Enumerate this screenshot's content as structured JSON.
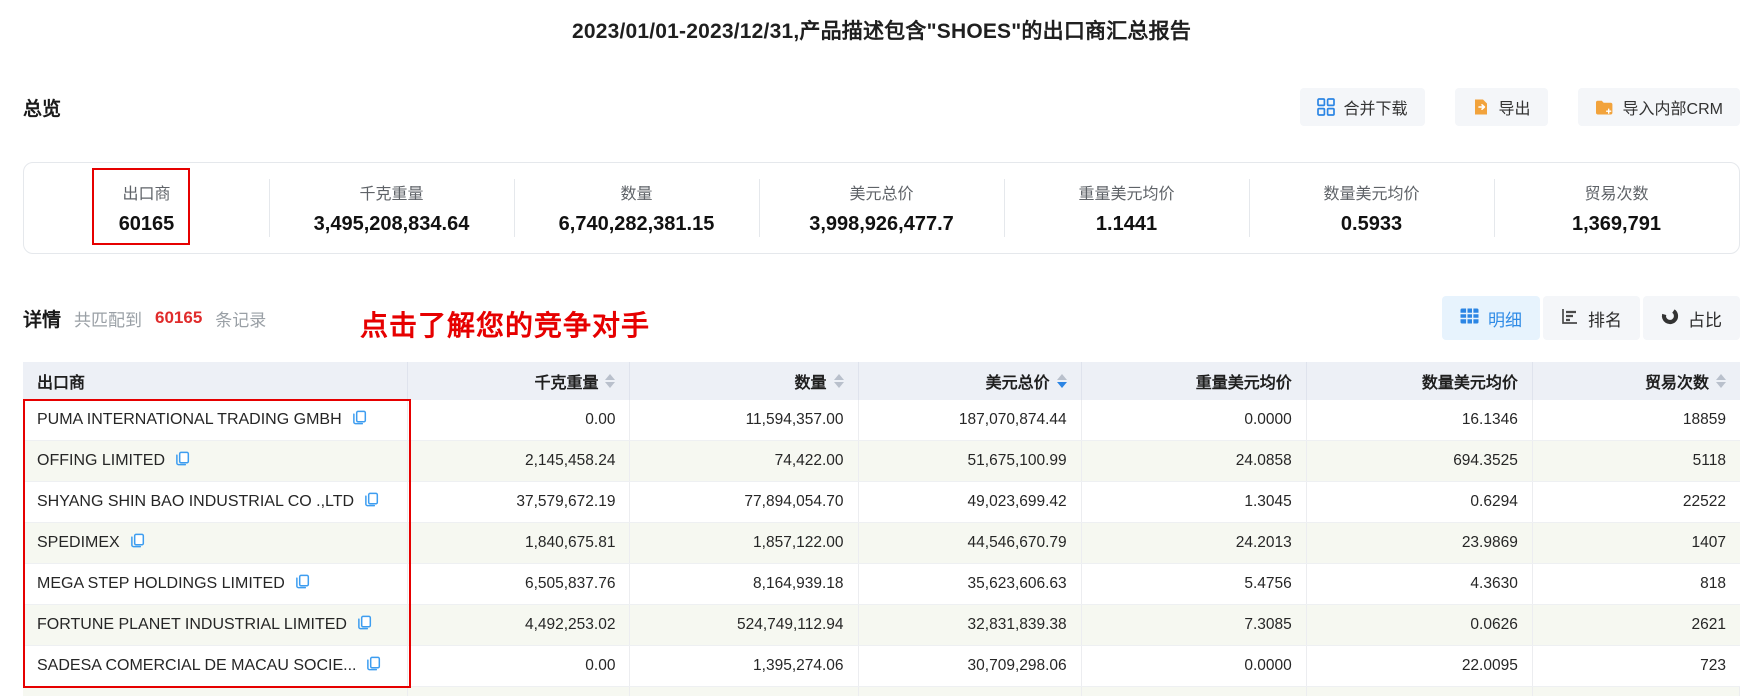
{
  "title": "2023/01/01-2023/12/31,产品描述包含\"SHOES\"的出口商汇总报告",
  "toolbar": {
    "section_title": "总览",
    "buttons": [
      {
        "label": "合并下载",
        "icon": "merge-download-icon"
      },
      {
        "label": "导出",
        "icon": "export-icon"
      },
      {
        "label": "导入内部CRM",
        "icon": "import-crm-icon"
      }
    ]
  },
  "stats": {
    "items": [
      {
        "label": "出口商",
        "value": "60165"
      },
      {
        "label": "千克重量",
        "value": "3,495,208,834.64"
      },
      {
        "label": "数量",
        "value": "6,740,282,381.15"
      },
      {
        "label": "美元总价",
        "value": "3,998,926,477.7"
      },
      {
        "label": "重量美元均价",
        "value": "1.1441"
      },
      {
        "label": "数量美元均价",
        "value": "0.5933"
      },
      {
        "label": "贸易次数",
        "value": "1,369,791"
      }
    ]
  },
  "details": {
    "section_title": "详情",
    "match_prefix": "共匹配到",
    "match_count": "60165",
    "match_suffix": "条记录",
    "annotation": "点击了解您的竞争对手",
    "view_buttons": [
      {
        "label": "明细",
        "icon": "table-grid-icon",
        "active": true
      },
      {
        "label": "排名",
        "icon": "ranking-bars-icon",
        "active": false
      },
      {
        "label": "占比",
        "icon": "donut-chart-icon",
        "active": false
      }
    ]
  },
  "table": {
    "columns": [
      {
        "label": "出口商",
        "sortable": false
      },
      {
        "label": "千克重量",
        "sortable": true
      },
      {
        "label": "数量",
        "sortable": true
      },
      {
        "label": "美元总价",
        "sortable": true,
        "sort": "desc"
      },
      {
        "label": "重量美元均价",
        "sortable": false
      },
      {
        "label": "数量美元均价",
        "sortable": false
      },
      {
        "label": "贸易次数",
        "sortable": true
      }
    ],
    "rows": [
      {
        "exporter": "PUMA INTERNATIONAL TRADING GMBH",
        "kg": "0.00",
        "qty": "11,594,357.00",
        "usd": "187,070,874.44",
        "usd_per_kg": "0.0000",
        "usd_per_qty": "16.1346",
        "trades": "18859"
      },
      {
        "exporter": "OFFING LIMITED",
        "kg": "2,145,458.24",
        "qty": "74,422.00",
        "usd": "51,675,100.99",
        "usd_per_kg": "24.0858",
        "usd_per_qty": "694.3525",
        "trades": "5118"
      },
      {
        "exporter": "SHYANG SHIN BAO INDUSTRIAL CO .,LTD",
        "kg": "37,579,672.19",
        "qty": "77,894,054.70",
        "usd": "49,023,699.42",
        "usd_per_kg": "1.3045",
        "usd_per_qty": "0.6294",
        "trades": "22522"
      },
      {
        "exporter": "SPEDIMEX",
        "kg": "1,840,675.81",
        "qty": "1,857,122.00",
        "usd": "44,546,670.79",
        "usd_per_kg": "24.2013",
        "usd_per_qty": "23.9869",
        "trades": "1407"
      },
      {
        "exporter": "MEGA STEP HOLDINGS LIMITED",
        "kg": "6,505,837.76",
        "qty": "8,164,939.18",
        "usd": "35,623,606.63",
        "usd_per_kg": "5.4756",
        "usd_per_qty": "4.3630",
        "trades": "818"
      },
      {
        "exporter": "FORTUNE PLANET INDUSTRIAL LIMITED",
        "kg": "4,492,253.02",
        "qty": "524,749,112.94",
        "usd": "32,831,839.38",
        "usd_per_kg": "7.3085",
        "usd_per_qty": "0.0626",
        "trades": "2621"
      },
      {
        "exporter": "SADESA COMERCIAL DE MACAU SOCIE...",
        "kg": "0.00",
        "qty": "1,395,274.06",
        "usd": "30,709,298.06",
        "usd_per_kg": "0.0000",
        "usd_per_qty": "22.0095",
        "trades": "723"
      }
    ]
  },
  "icons": {
    "copy": "copy-icon",
    "merge_download": "merge-download-icon",
    "export": "export-icon",
    "import_crm": "import-crm-icon",
    "detail_view": "table-grid-icon",
    "ranking_view": "ranking-bars-icon",
    "share_view": "donut-chart-icon"
  },
  "colors": {
    "accent_blue": "#2b85e4",
    "annotation_red": "#e60000",
    "count_red": "#e02b2b",
    "icon_orange": "#f2a33c",
    "table_header_bg": "#edf0f6",
    "row_stripe": "#f6f8f1"
  }
}
